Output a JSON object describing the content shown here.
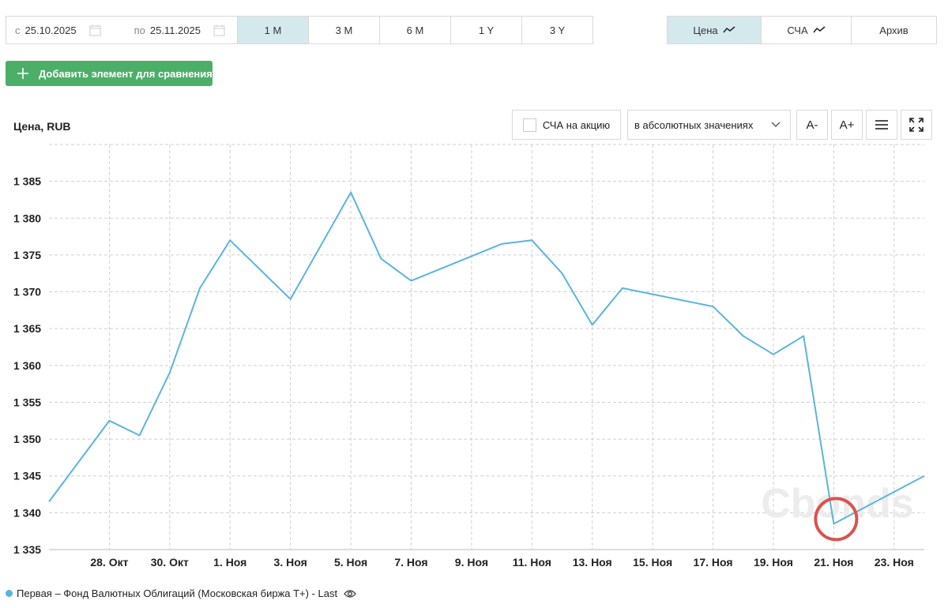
{
  "toolbar": {
    "date_from_prefix": "с",
    "date_from": "25.10.2025",
    "date_to_prefix": "по",
    "date_to": "25.11.2025",
    "periods": [
      "1 M",
      "3 M",
      "6 M",
      "1 Y",
      "3 Y"
    ],
    "active_period": "1 M",
    "views": [
      "Цена",
      "СЧА",
      "Архив"
    ],
    "active_view": "Цена"
  },
  "add_button": {
    "label": "Добавить элемент для сравнения"
  },
  "chart_controls": {
    "nav_checkbox_label": "СЧА на акцию",
    "mode_select": "в абсолютных значениях",
    "font_decrease": "A-",
    "font_increase": "A+"
  },
  "watermark": "Cbonds",
  "legend": {
    "label": "Первая – Фонд Валютных Облигаций (Московская биржа Т+) - Last",
    "color": "#5ab4e0"
  },
  "chart_data": {
    "type": "line",
    "ylabel": "Цена, RUB",
    "ylim": [
      1335,
      1390
    ],
    "yticks": [
      1335,
      1340,
      1345,
      1350,
      1355,
      1360,
      1365,
      1370,
      1375,
      1380,
      1385
    ],
    "ytick_labels": [
      "1 335",
      "1 340",
      "1 345",
      "1 350",
      "1 355",
      "1 360",
      "1 365",
      "1 370",
      "1 375",
      "1 380",
      "1 385"
    ],
    "xlim": [
      "2025-10-26",
      "2025-11-24"
    ],
    "xticks": [
      "2025-10-28",
      "2025-10-30",
      "2025-11-01",
      "2025-11-03",
      "2025-11-05",
      "2025-11-07",
      "2025-11-09",
      "2025-11-11",
      "2025-11-13",
      "2025-11-15",
      "2025-11-17",
      "2025-11-19",
      "2025-11-21",
      "2025-11-23"
    ],
    "xtick_labels": [
      "28. Окт",
      "30. Окт",
      "1. Ноя",
      "3. Ноя",
      "5. Ноя",
      "7. Ноя",
      "9. Ноя",
      "11. Ноя",
      "13. Ноя",
      "15. Ноя",
      "17. Ноя",
      "19. Ноя",
      "21. Ноя",
      "23. Ноя"
    ],
    "grid": true,
    "series": [
      {
        "name": "Первая – Фонд Валютных Облигаций (Московская биржа Т+) - Last",
        "color": "#5ab4e0",
        "x": [
          "2025-10-26",
          "2025-10-28",
          "2025-10-29",
          "2025-10-30",
          "2025-10-31",
          "2025-11-01",
          "2025-11-03",
          "2025-11-05",
          "2025-11-06",
          "2025-11-07",
          "2025-11-10",
          "2025-11-11",
          "2025-11-12",
          "2025-11-13",
          "2025-11-14",
          "2025-11-17",
          "2025-11-18",
          "2025-11-19",
          "2025-11-20",
          "2025-11-21",
          "2025-11-24"
        ],
        "values": [
          1341.5,
          1352.5,
          1350.5,
          1359,
          1370.5,
          1377,
          1369,
          1383.5,
          1374.5,
          1371.5,
          1376.5,
          1377,
          1372.5,
          1365.5,
          1370.5,
          1368,
          1364,
          1361.5,
          1364,
          1338.5,
          1345
        ]
      }
    ],
    "highlight": {
      "x": "2025-11-21",
      "y": 1338.5,
      "color": "#d9534f"
    }
  }
}
